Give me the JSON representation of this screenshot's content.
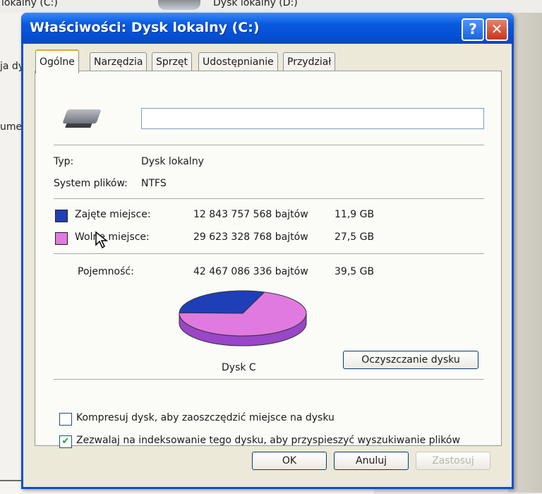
{
  "background": {
    "drive_c_label": "lokalny (C:)",
    "drive_d_label": "Dysk lokalny (D:)",
    "left_text_1": "ja dy",
    "left_text_2": "umer"
  },
  "dialog": {
    "title": "Właściwości: Dysk lokalny (C:)",
    "help_glyph": "?",
    "close_glyph": "✕",
    "tabs": [
      "Ogólne",
      "Narzędzia",
      "Sprzęt",
      "Udostępnianie",
      "Przydział"
    ],
    "active_tab": "Ogólne"
  },
  "general": {
    "drive_name_value": "",
    "type_label": "Typ:",
    "type_value": "Dysk lokalny",
    "fs_label": "System plików:",
    "fs_value": "NTFS",
    "used_label": "Zajęte miejsce:",
    "used_bytes": "12 843 757 568 bajtów",
    "used_gb": "11,9 GB",
    "free_label": "Wolne miejsce:",
    "free_bytes": "29 623 328 768 bajtów",
    "free_gb": "27,5 GB",
    "capacity_label": "Pojemność:",
    "capacity_bytes": "42 467 086 336 bajtów",
    "capacity_gb": "39,5 GB",
    "chart_caption": "Dysk C",
    "cleanup_button": "Oczyszczanie dysku",
    "compress_label": "Kompresuj dysk, aby zaoszczędzić miejsce na dysku",
    "compress_checked": false,
    "index_label": "Zezwalaj na indeksowanie tego dysku, aby przyspieszyć wyszukiwanie plików",
    "index_checked": true
  },
  "footer": {
    "ok": "OK",
    "cancel": "Anuluj",
    "apply": "Zastosuj"
  },
  "colors": {
    "used": "#1f3fb8",
    "free": "#e07ae0",
    "used_side": "#15287a",
    "free_side": "#9a46c8"
  },
  "chart_data": {
    "type": "pie",
    "categories": [
      "Zajęte miejsce",
      "Wolne miejsce"
    ],
    "values": [
      11.9,
      27.5
    ]
  }
}
